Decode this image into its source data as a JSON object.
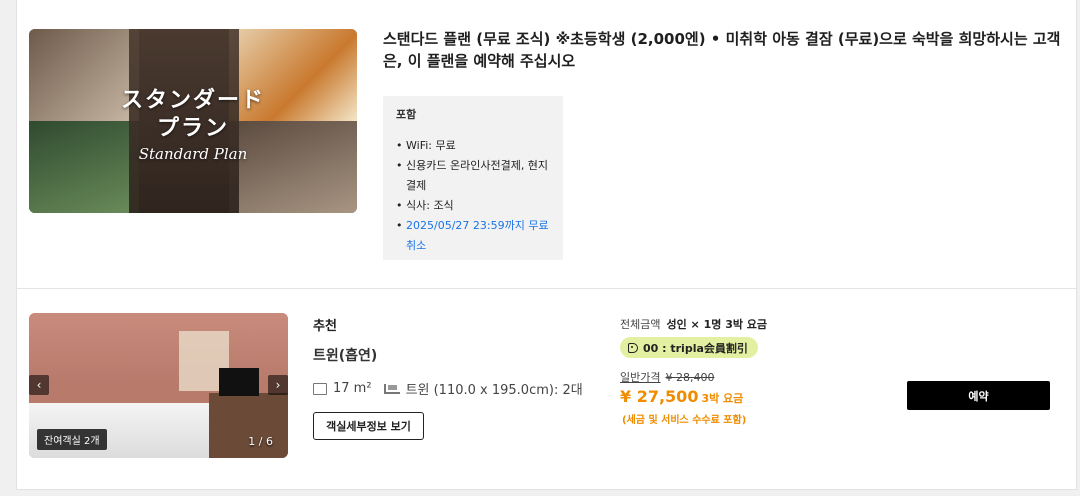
{
  "plan": {
    "image": {
      "jp_line1": "スタンダード",
      "jp_line2": "プラン",
      "en": "Standard Plan"
    },
    "title": "스탠다드 플랜 (무료 조식) ※초등학생 (2,000엔) • 미취학 아동 결잠 (무료)으로 숙박을 희망하시는 고객은, 이 플랜을 예약해 주십시오",
    "includes": {
      "header": "포함",
      "items": [
        "WiFi: 무료",
        "신용카드 온라인사전결제, 현지결제",
        "식사: 조식",
        "2025/05/27 23:59까지 무료취소"
      ]
    }
  },
  "room": {
    "image": {
      "prev_icon": "‹",
      "next_icon": "›",
      "vacancy": "잔여객실 2개",
      "counter": "1 / 6"
    },
    "recommend": "추천",
    "name": "트윈(흡연)",
    "size": "17 m²",
    "beds": "트윈 (110.0 x 195.0cm): 2대",
    "detail_button": "객실세부정보 보기"
  },
  "pricing": {
    "total_label": "전체금액",
    "total_desc": "성인 × 1명 3박 요금",
    "promo": "00 : tripla会員割引",
    "regular_label": "일반가격",
    "regular_price": "¥ 28,400",
    "price": "¥ 27,500",
    "price_unit": "3박 요금",
    "tax_note": "(세금 및 서비스 수수료 포함)",
    "book_button": "예약"
  },
  "colors": {
    "accent_orange": "#f08c00",
    "promo_bg": "#e3f0a2",
    "link_blue": "#1a73e8"
  }
}
